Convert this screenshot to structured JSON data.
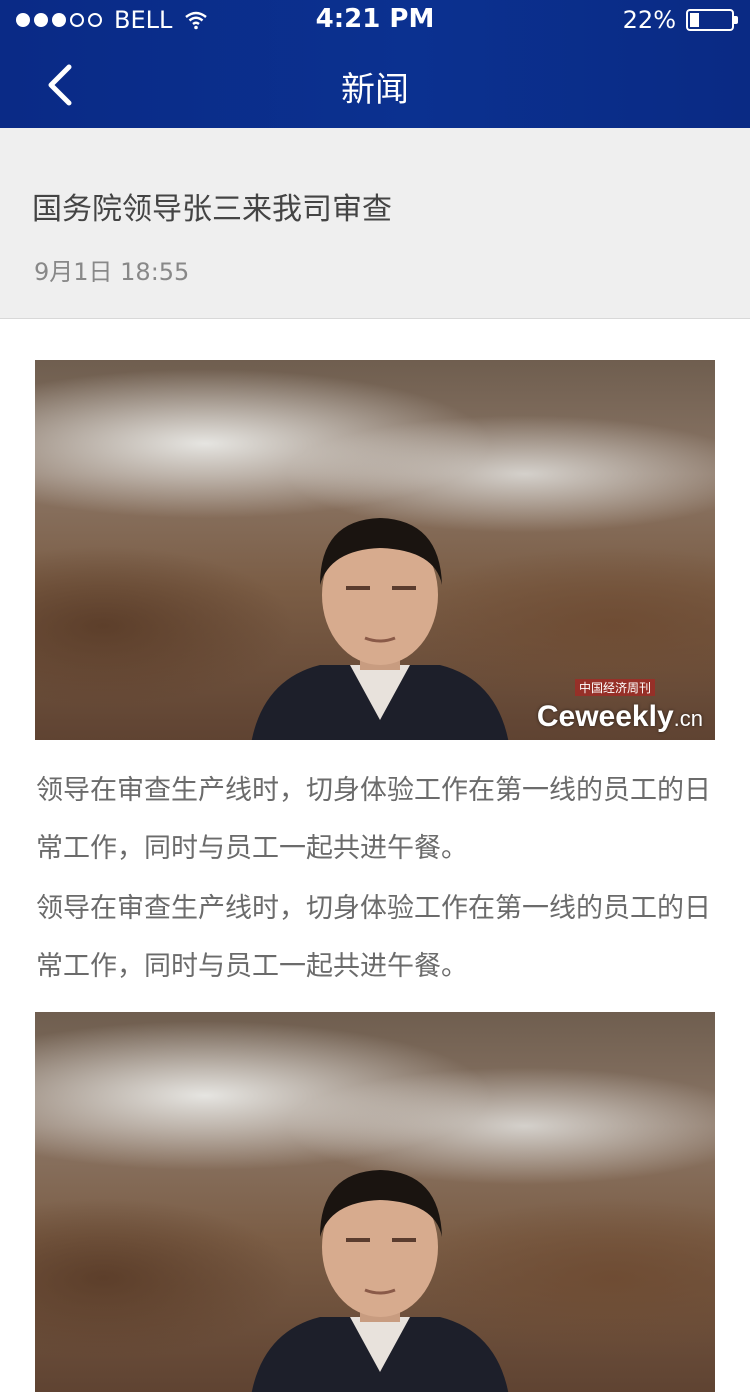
{
  "status_bar": {
    "carrier": "BELL",
    "time": "4:21 PM",
    "battery_percent": "22%",
    "battery_level": 0.22,
    "signal_bars_filled": 3,
    "signal_bars_total": 5
  },
  "nav": {
    "title": "新闻",
    "back_icon": "chevron-left-icon"
  },
  "article": {
    "title": "国务院领导张三来我司审查",
    "time": "9月1日 18:55",
    "paragraphs": [
      "领导在审查生产线时，切身体验工作在第一线的员工的日常工作，同时与员工一起共进午餐。",
      "领导在审查生产线时，切身体验工作在第一线的员工的日常工作，同时与员工一起共进午餐。"
    ],
    "image_watermark": "Ceweekly",
    "image_watermark_suffix": ".cn",
    "image_watermark_top": "中国经济周刊"
  },
  "colors": {
    "header_bg": "#0b2d8a",
    "title_block_bg": "#efefef",
    "body_text": "#6b6b6b"
  }
}
